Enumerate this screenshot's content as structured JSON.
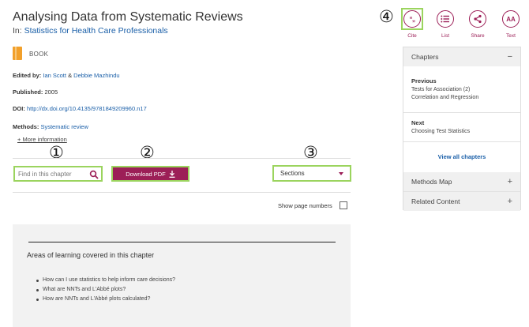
{
  "header": {
    "title": "Analysing Data from Systematic Reviews",
    "in_prefix": "In:",
    "in_link": "Statistics for Health Care Professionals",
    "type_label": "BOOK"
  },
  "meta": {
    "edited_label": "Edited by:",
    "editor1": "Ian Scott",
    "amp": "&",
    "editor2": "Debbie Mazhindu",
    "published_label": "Published:",
    "published_value": "2005",
    "doi_label": "DOI:",
    "doi_value": "http://dx.doi.org/10.4135/9781849209960.n17",
    "methods_label": "Methods:",
    "methods_value": "Systematic review",
    "more_info": "+ More information"
  },
  "markers": [
    "①",
    "②",
    "③",
    "④"
  ],
  "toolbar": {
    "search_placeholder": "Find in this chapter",
    "download_label": "Download PDF",
    "sections_label": "Sections",
    "show_page_numbers": "Show page numbers"
  },
  "panel": {
    "areas_title": "Areas of learning covered in this chapter",
    "bullets": [
      "How can I use statistics to help inform care decisions?",
      "What are NNTs and L'Abbé plots?",
      "How are NNTs and L'Abbé plots calculated?"
    ]
  },
  "tools": [
    {
      "label": "Cite",
      "glyph": "“,,",
      "icon": "quote-icon"
    },
    {
      "label": "List",
      "glyph": "≡",
      "icon": "list-icon"
    },
    {
      "label": "Share",
      "glyph": "<",
      "icon": "share-icon"
    },
    {
      "label": "Text",
      "glyph": "AA",
      "icon": "text-size-icon"
    }
  ],
  "sidebar": {
    "chapters_label": "Chapters",
    "chapters_sign": "−",
    "previous_label": "Previous",
    "previous_title_1": "Tests for Association (2)",
    "previous_title_2": "Correlation and Regression",
    "next_label": "Next",
    "next_title": "Choosing Test Statistics",
    "view_all": "View all chapters",
    "methods_map": "Methods Map",
    "related_content": "Related Content",
    "plus": "+"
  },
  "colors": {
    "accent": "#9c1f57",
    "highlight": "#9bd45e",
    "link": "#1a5fa8",
    "book_icon": "#f2a02b"
  }
}
